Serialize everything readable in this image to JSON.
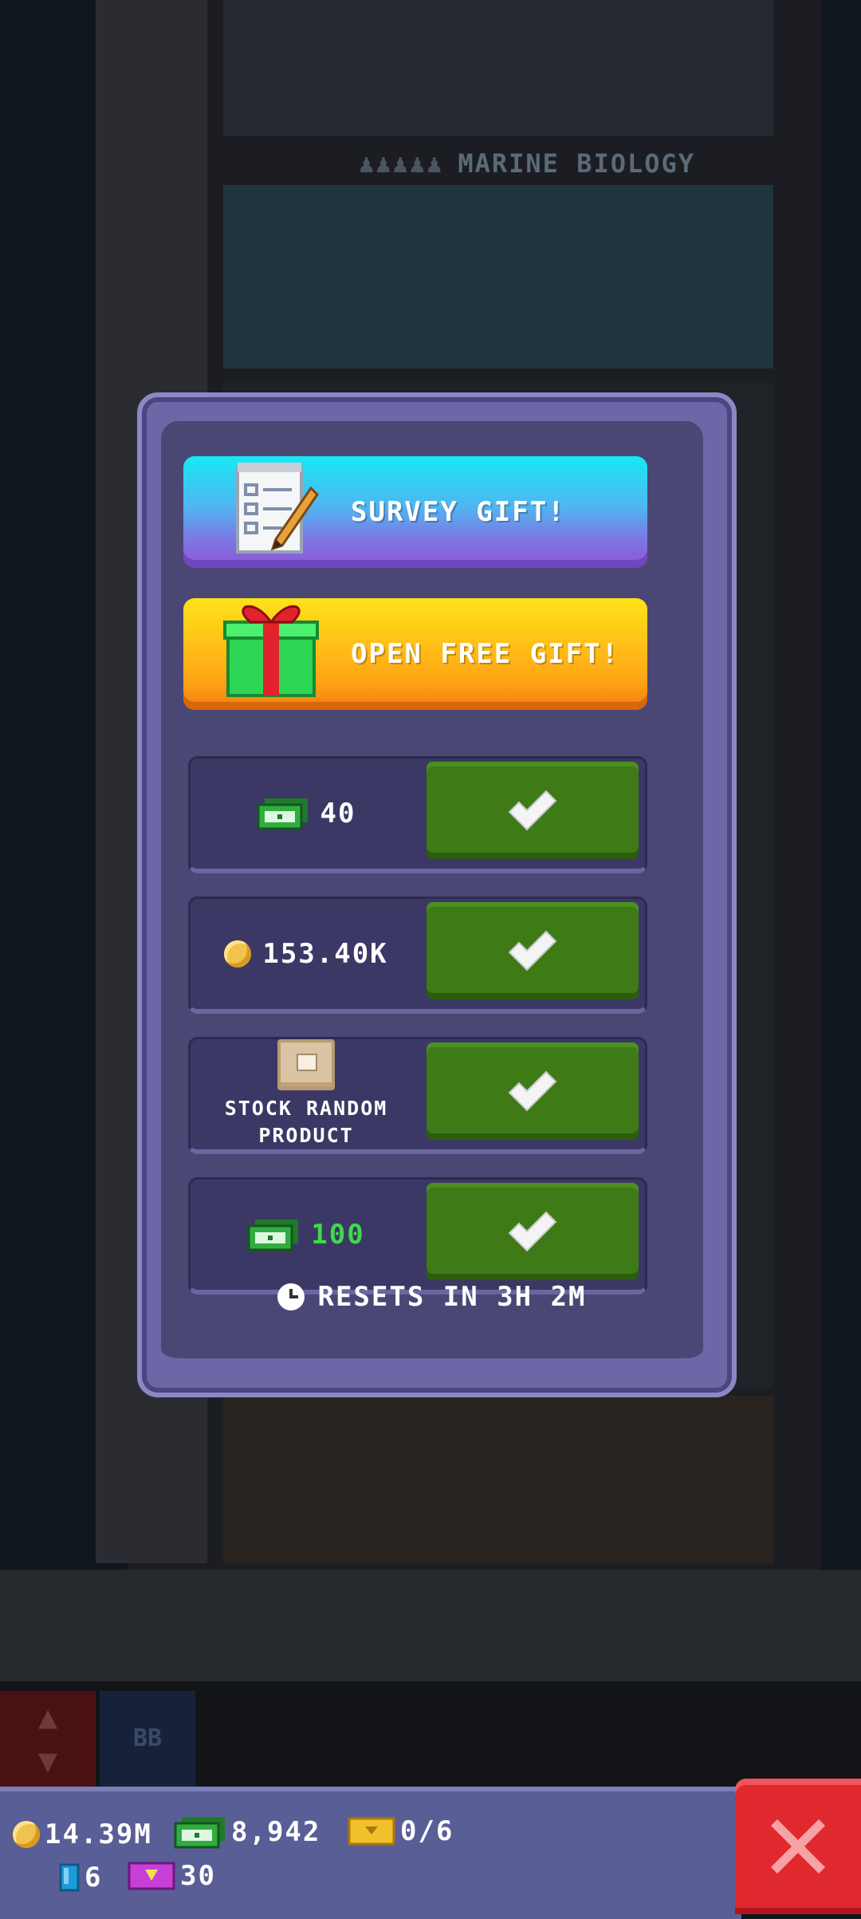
{
  "background": {
    "floor_label": "MARINE BIOLOGY",
    "elevator_button_b": "BB"
  },
  "dialog": {
    "survey_button": {
      "label": "SURVEY GIFT!",
      "icon": "notepad-pencil-icon"
    },
    "free_gift_button": {
      "label": "OPEN FREE GIFT!",
      "icon": "gift-box-icon"
    },
    "rewards": [
      {
        "icon": "cash-icon",
        "value": "40",
        "color": "#ffffff",
        "claimed": true
      },
      {
        "icon": "coin-icon",
        "value": "153.40K",
        "color": "#ffffff",
        "claimed": true
      },
      {
        "icon": "product-box-icon",
        "value": "STOCK RANDOM PRODUCT",
        "color": "#ffffff",
        "claimed": true
      },
      {
        "icon": "cash-icon",
        "value": "100",
        "color": "#40d84a",
        "claimed": true
      }
    ],
    "resets": "RESETS IN 3H 2M"
  },
  "status_bar": {
    "coins": "14.39M",
    "bux": "8,942",
    "tickets": "0/6",
    "gems": "6",
    "vip": "30"
  },
  "colors": {
    "panel": "#6c67a6",
    "claim_green": "#3e7b17",
    "close_red": "#e0292f"
  }
}
